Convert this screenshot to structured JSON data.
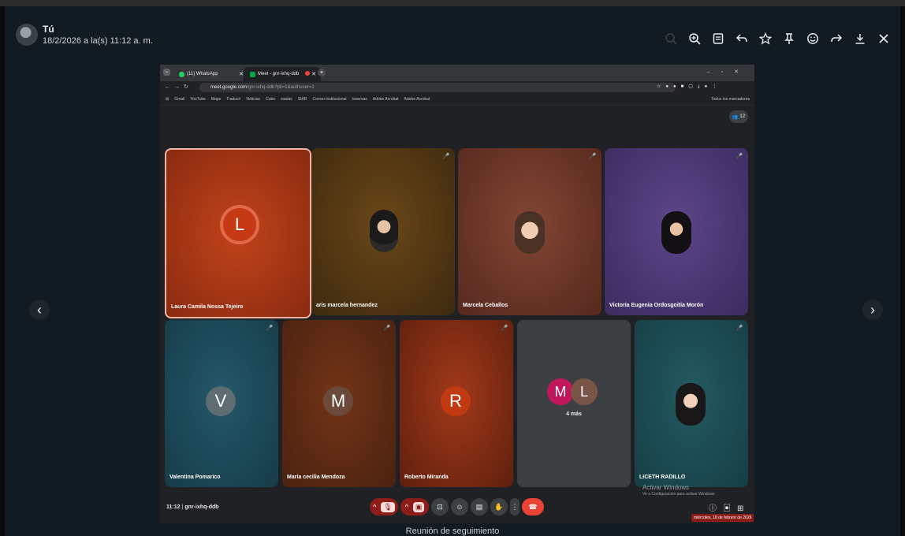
{
  "viewer": {
    "sender_name": "Tú",
    "sender_time": "18/2/2026 a la(s) 11:12 a. m.",
    "caption": "Reunión de seguimiento",
    "toolbar_icons": [
      "zoom-out-icon",
      "zoom-in-icon",
      "document-icon",
      "reply-icon",
      "star-icon",
      "pin-icon",
      "emoji-icon",
      "forward-icon",
      "download-icon",
      "close-icon"
    ]
  },
  "browser": {
    "tabs": [
      {
        "label": "(11) WhatsApp"
      },
      {
        "label": "Meet - gnr-ixhq-ddb"
      }
    ],
    "url_main": "meet.google.com",
    "url_rest": "/gnr-ixhq-ddb?pli=1&authuser=1",
    "bookmarks": [
      "Gmail",
      "YouTube",
      "Maps",
      "Traducir",
      "Noticias",
      "Cubo",
      "eaulas",
      "SIAR",
      "Correo Institucional",
      "reservas",
      "Adobe Acrobat",
      "Adobe Acrobat"
    ],
    "all_bookmarks": "Todos los marcadores"
  },
  "meet": {
    "participant_count": "12",
    "participants": [
      {
        "name": "Laura Camila Nossa Tejeiro",
        "initial": "L"
      },
      {
        "name": "aris marcela hernandez"
      },
      {
        "name": "Marcela Ceballos"
      },
      {
        "name": "Victoria Eugenia Ordosgoitia Morón"
      },
      {
        "name": "Valentina Pomarico",
        "initial": "V"
      },
      {
        "name": "Maria cecilia Mendoza",
        "initial": "M"
      },
      {
        "name": "Roberto Miranda",
        "initial": "R"
      },
      {
        "name": "4 más",
        "initials": [
          "M",
          "L"
        ]
      },
      {
        "name": "LICETH RADILLO"
      }
    ],
    "meeting_time": "11:12",
    "meeting_code": "gnr-ixhq-ddb",
    "watermark_title": "Activar Windows",
    "watermark_sub": "Ve a Configuración para activar Windows.",
    "date_tooltip": "miércoles, 18 de febrero de 2026",
    "colors": {
      "tile1": "#b33a18",
      "tile2": "#5a3a12",
      "tile3": "#6d3424",
      "tile4": "#4e3a78",
      "tile5": "#1d4d5c",
      "tile6": "#6a3016",
      "tile7": "#8c2e14",
      "tile8": "#3c4043",
      "tile9": "#1e4c55"
    }
  }
}
